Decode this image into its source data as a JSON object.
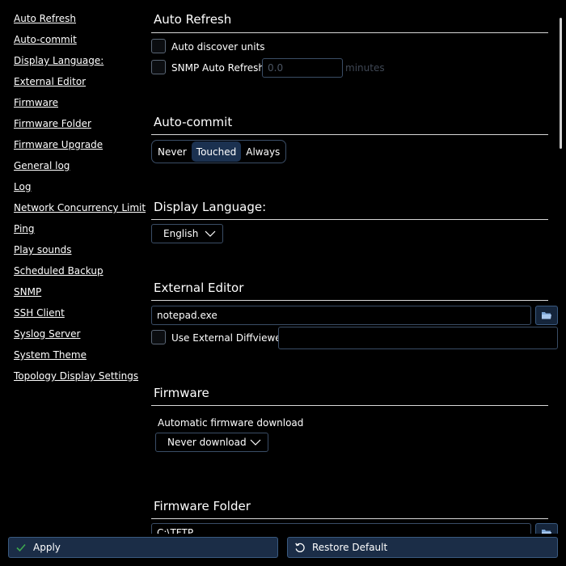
{
  "sidebar": {
    "items": [
      {
        "label": "Auto Refresh"
      },
      {
        "label": "Auto-commit"
      },
      {
        "label": "Display Language:"
      },
      {
        "label": "External Editor"
      },
      {
        "label": "Firmware"
      },
      {
        "label": "Firmware Folder"
      },
      {
        "label": "Firmware Upgrade"
      },
      {
        "label": "General log"
      },
      {
        "label": "Log"
      },
      {
        "label": "Network Concurrency Limit"
      },
      {
        "label": "Ping"
      },
      {
        "label": "Play sounds"
      },
      {
        "label": "Scheduled Backup"
      },
      {
        "label": "SNMP"
      },
      {
        "label": "SSH Client"
      },
      {
        "label": "Syslog Server"
      },
      {
        "label": "System Theme"
      },
      {
        "label": "Topology Display Settings"
      }
    ]
  },
  "auto_refresh": {
    "title": "Auto Refresh",
    "auto_discover_label": "Auto discover units",
    "snmp_refresh_label": "SNMP Auto Refresh",
    "snmp_refresh_placeholder": "0.0",
    "unit_label": "minutes"
  },
  "auto_commit": {
    "title": "Auto-commit",
    "options": [
      "Never",
      "Touched",
      "Always"
    ],
    "selected": "Touched"
  },
  "display_language": {
    "title": "Display Language:",
    "selected": "English"
  },
  "external_editor": {
    "title": "External Editor",
    "editor_value": "notepad.exe",
    "diff_label": "Use External Diffviewer",
    "diff_value": ""
  },
  "firmware": {
    "title": "Firmware",
    "download_label": "Automatic firmware download",
    "download_selected": "Never download"
  },
  "firmware_folder": {
    "title": "Firmware Folder",
    "folder_value": "C:\\TFTP"
  },
  "footer": {
    "apply_label": "Apply",
    "restore_label": "Restore Default"
  },
  "colors": {
    "background": "#000000",
    "accent": "#1b3150",
    "border": "#3a4d66",
    "apply_check": "#3ea84f"
  }
}
